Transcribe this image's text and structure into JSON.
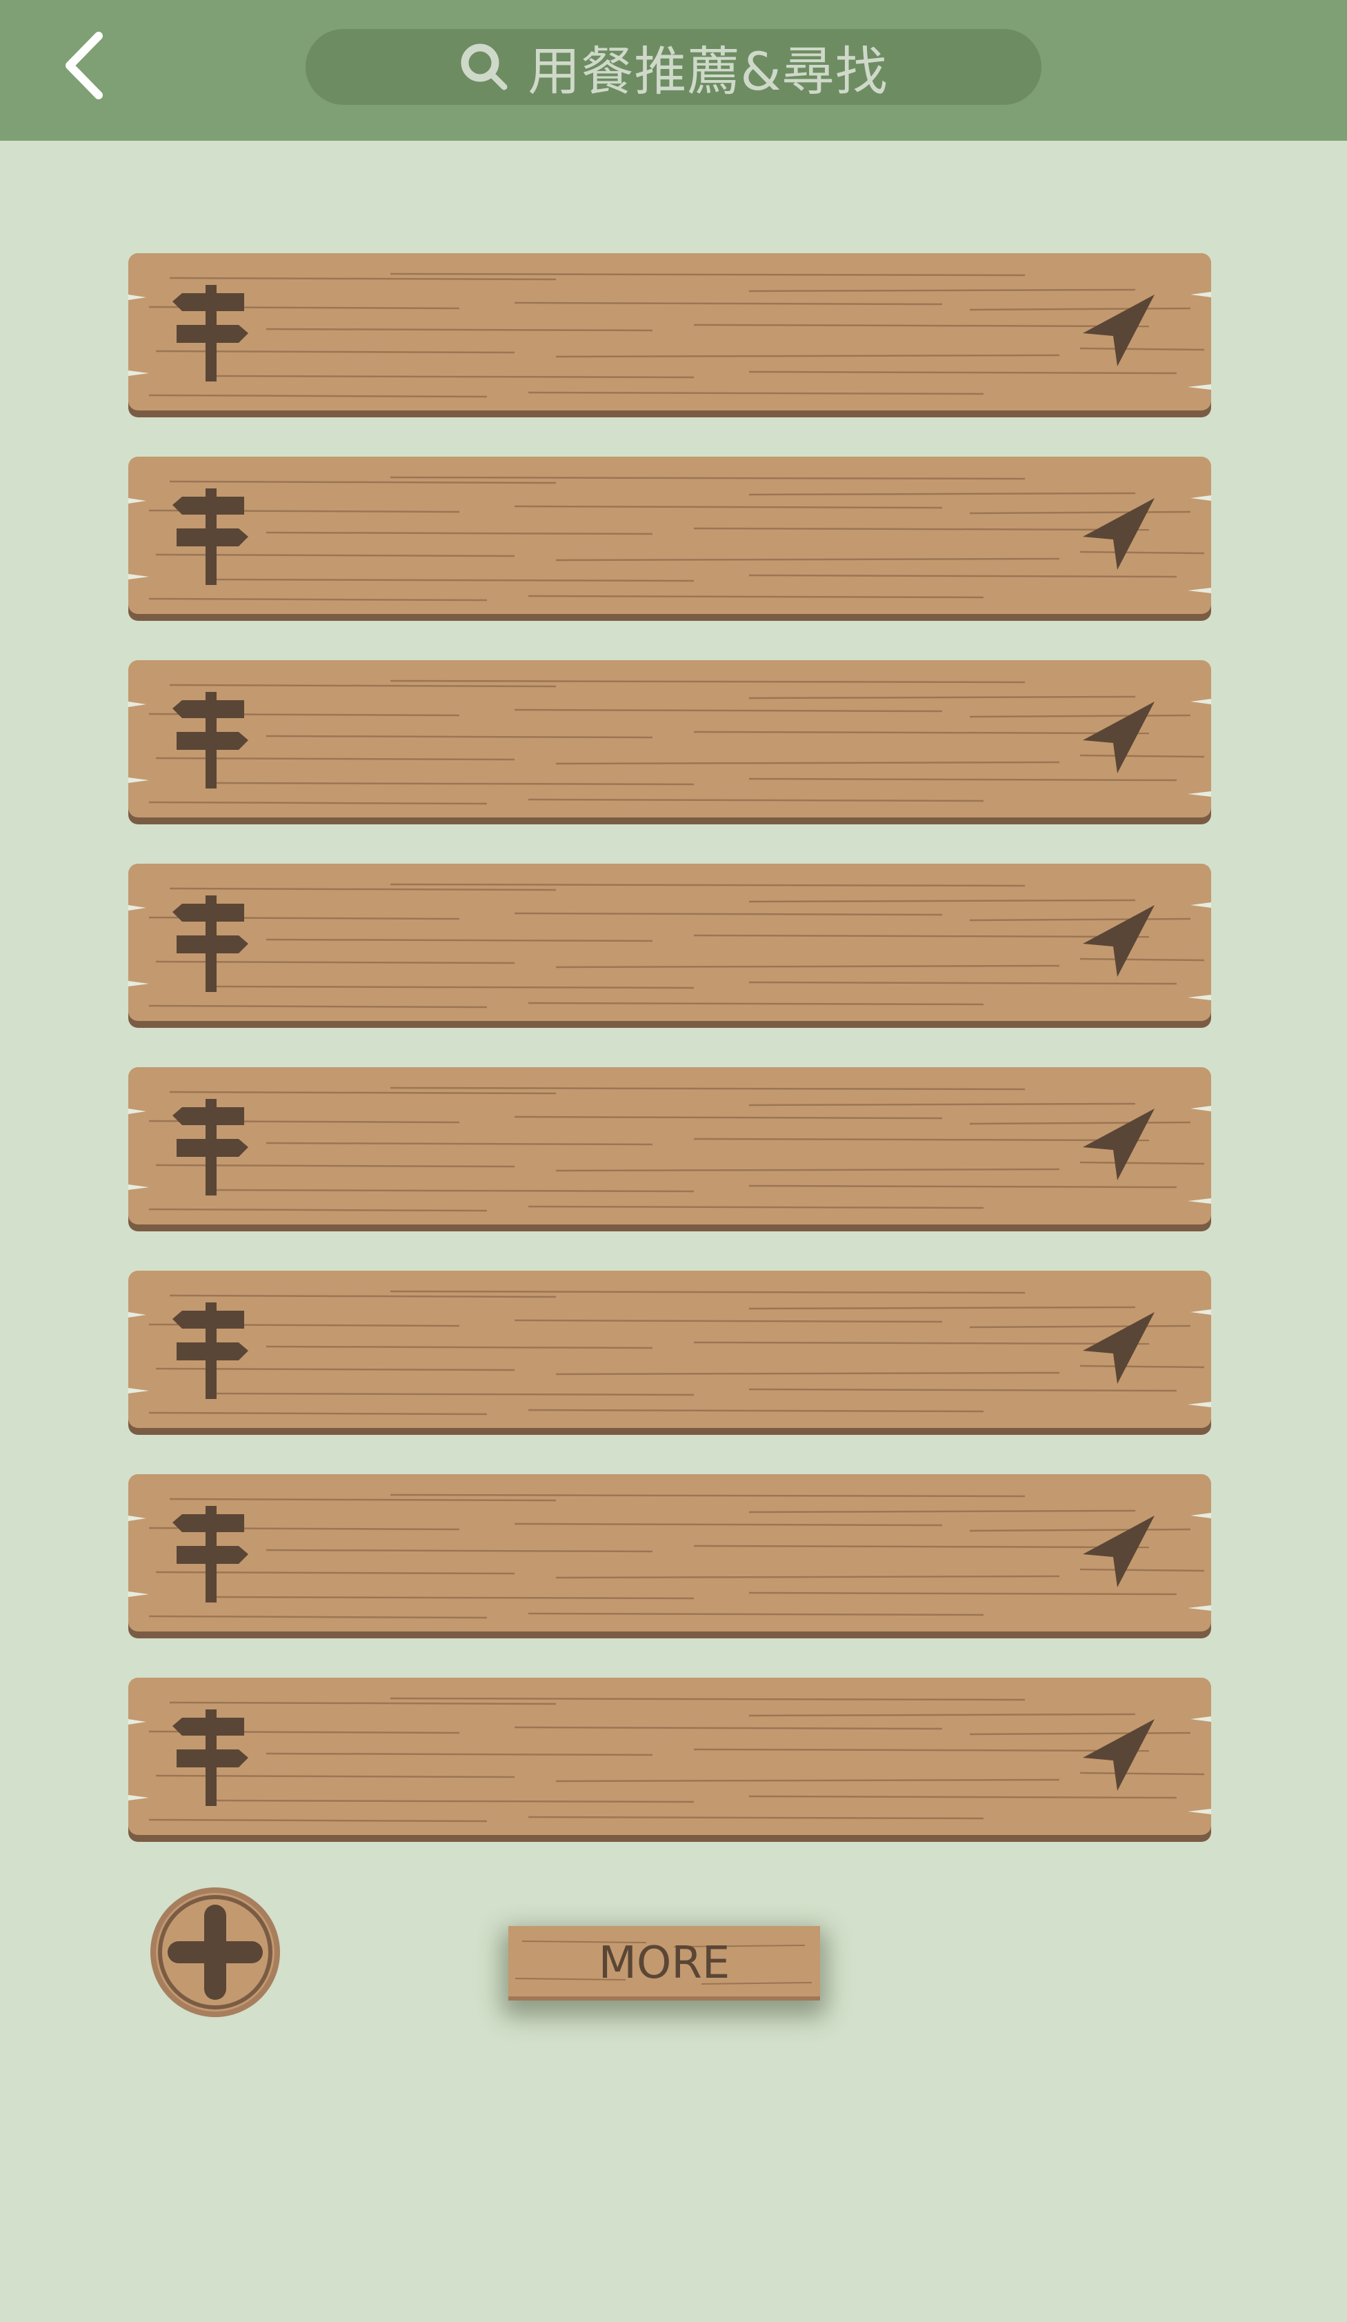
{
  "header": {
    "back_icon": "chevron-left-icon",
    "search": {
      "icon": "search-icon",
      "text": "用餐推薦&尋找"
    },
    "background": "#7f9f74",
    "search_bg": "#6d8c62"
  },
  "list": {
    "items": [
      {
        "label": "",
        "icon_left": "signpost-icon",
        "icon_right": "navigation-arrow-icon"
      },
      {
        "label": "",
        "icon_left": "signpost-icon",
        "icon_right": "navigation-arrow-icon"
      },
      {
        "label": "",
        "icon_left": "signpost-icon",
        "icon_right": "navigation-arrow-icon"
      },
      {
        "label": "",
        "icon_left": "signpost-icon",
        "icon_right": "navigation-arrow-icon"
      },
      {
        "label": "",
        "icon_left": "signpost-icon",
        "icon_right": "navigation-arrow-icon"
      },
      {
        "label": "",
        "icon_left": "signpost-icon",
        "icon_right": "navigation-arrow-icon"
      },
      {
        "label": "",
        "icon_left": "signpost-icon",
        "icon_right": "navigation-arrow-icon"
      },
      {
        "label": "",
        "icon_left": "signpost-icon",
        "icon_right": "navigation-arrow-icon"
      }
    ],
    "wood_color": "#c3996f",
    "wood_edge": "#7a5c45",
    "icon_color": "#5a4636"
  },
  "footer": {
    "add_icon": "plus-icon",
    "more_label": "MORE"
  },
  "page_background": "#d3e0cb"
}
